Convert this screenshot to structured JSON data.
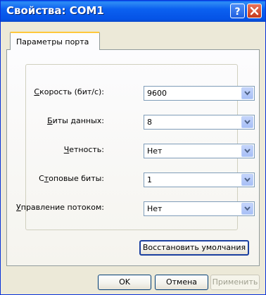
{
  "window": {
    "title": "Свойства: COM1",
    "help_icon": "help-icon",
    "close_icon": "close-icon"
  },
  "tabs": [
    {
      "label": "Параметры порта",
      "selected": true
    }
  ],
  "fields": [
    {
      "label": "Скорость (бит/с):",
      "value": "9600"
    },
    {
      "label": "Биты данных:",
      "value": "8"
    },
    {
      "label": "Четность:",
      "value": "Нет"
    },
    {
      "label": "Стоповые биты:",
      "value": "1"
    },
    {
      "label": "Управление потоком:",
      "value": "Нет"
    }
  ],
  "buttons": {
    "restore_label": "Восстановить умолчания",
    "ok_label": "OK",
    "cancel_label": "Отмена",
    "apply_label": "Применить"
  },
  "colors": {
    "titlebar": "#0553e6",
    "close": "#c6391c",
    "tab_highlight": "#ffc83c"
  }
}
